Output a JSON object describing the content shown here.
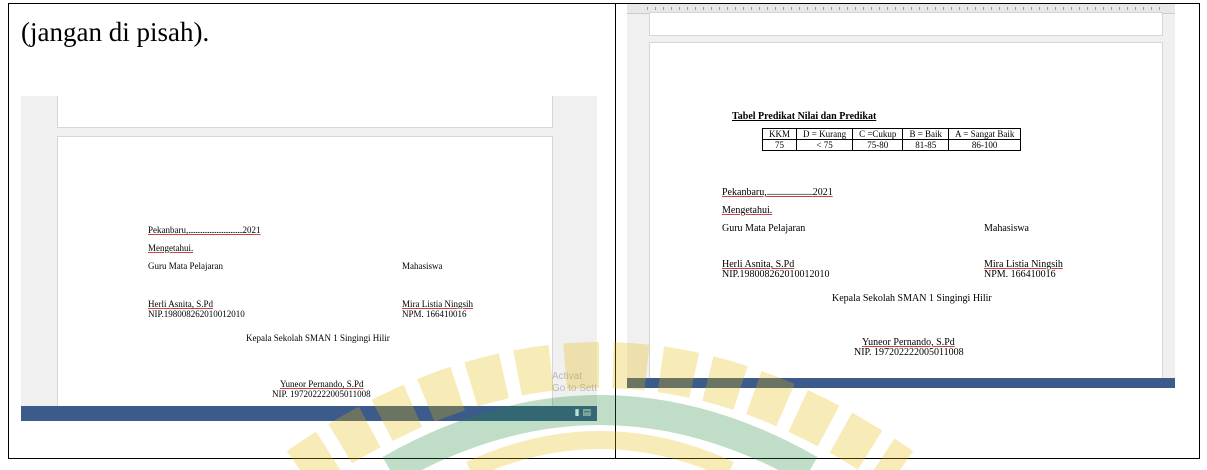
{
  "caption": "(jangan di pisah).",
  "left_doc": {
    "date_line": "Pekanbaru,",
    "date_dots": "...............................",
    "year": "2021",
    "mengetahui": "Mengetahui.",
    "guru_label": "Guru Mata Pelajaran",
    "mahasiswa_label": "Mahasiswa",
    "guru_name": "Herli Asnita, S.Pd",
    "guru_nip": "NIP.198008262010012010",
    "mhs_name": "Mira Listia Ningsih",
    "mhs_npm": "NPM. 166410016",
    "kepala_label": "Kepala Sekolah SMAN 1 Singingi Hilir",
    "kepala_name": "Yuneor Pernando, S.Pd",
    "kepala_nip": "NIP. 197202222005011008",
    "watermark_line1": "Activat",
    "watermark_line2": "Go to Sett"
  },
  "right_doc": {
    "table_title": "Tabel Predikat Nilai dan Predikat",
    "table": {
      "header": [
        "KKM",
        "D = Kurang",
        "C =Cukup",
        "B = Baik",
        "A = Sangat Baik"
      ],
      "row": [
        "75",
        "< 75",
        "75-80",
        "81-85",
        "86-100"
      ]
    },
    "date_line": "Pekanbaru,",
    "date_dots": ".......................",
    "year": "2021",
    "mengetahui": "Mengetahui.",
    "guru_label": "Guru Mata Pelajaran",
    "mahasiswa_label": "Mahasiswa",
    "guru_name": "Herli Asnita, S.Pd",
    "guru_nip": "NIP.198008262010012010",
    "mhs_name": "Mira Listia Ningsih",
    "mhs_npm": "NPM. 166410016",
    "kepala_label": "Kepala Sekolah SMAN 1 Singingi Hilir",
    "kepala_name": "Yuneor Pernando, S.Pd",
    "kepala_nip": "NIP. 197202222005011008"
  },
  "colors": {
    "taskbar": "#3c5a8a",
    "logo_yellow": "#e6b800",
    "logo_green": "#1f8a3a"
  }
}
